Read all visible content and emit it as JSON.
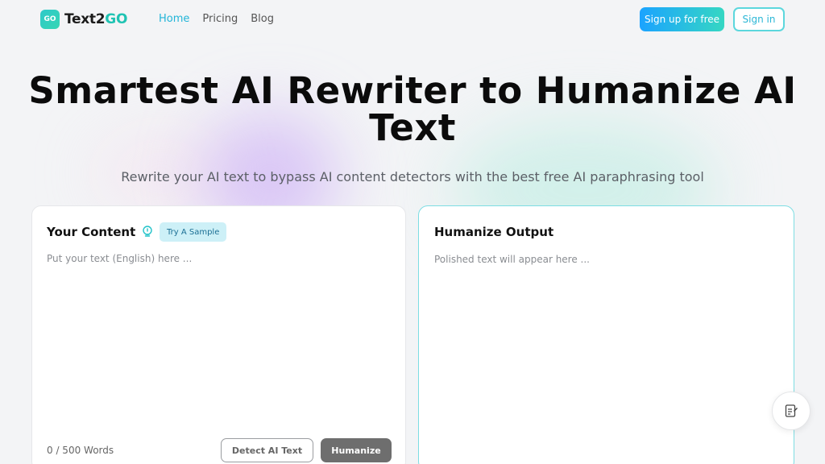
{
  "brand": {
    "logo_badge": "GO",
    "name_prefix": "Text2",
    "name_suffix": "GO"
  },
  "nav": {
    "items": [
      {
        "label": "Home",
        "active": true
      },
      {
        "label": "Pricing"
      },
      {
        "label": "Blog"
      }
    ]
  },
  "auth": {
    "signup_label": "Sign up for free",
    "signin_label": "Sign in"
  },
  "hero": {
    "title": "Smartest AI Rewriter to Humanize AI Text",
    "subtitle": "Rewrite your AI text to bypass AI content detectors with the best free AI paraphrasing tool"
  },
  "input_panel": {
    "title": "Your Content",
    "sample_label": "Try A Sample",
    "placeholder": "Put your text (English) here ...",
    "value": "",
    "word_count": "0 / 500 Words",
    "detect_label": "Detect AI Text",
    "humanize_label": "Humanize"
  },
  "output_panel": {
    "title": "Humanize Output",
    "placeholder": "Polished text will appear here ..."
  },
  "colors": {
    "accent": "#22b5d8",
    "brand": "#1fc3b3",
    "humanize_button": "#6e6e6e"
  },
  "icons": {
    "tip": "lightbulb-icon",
    "floating_action": "note-edit-icon"
  }
}
